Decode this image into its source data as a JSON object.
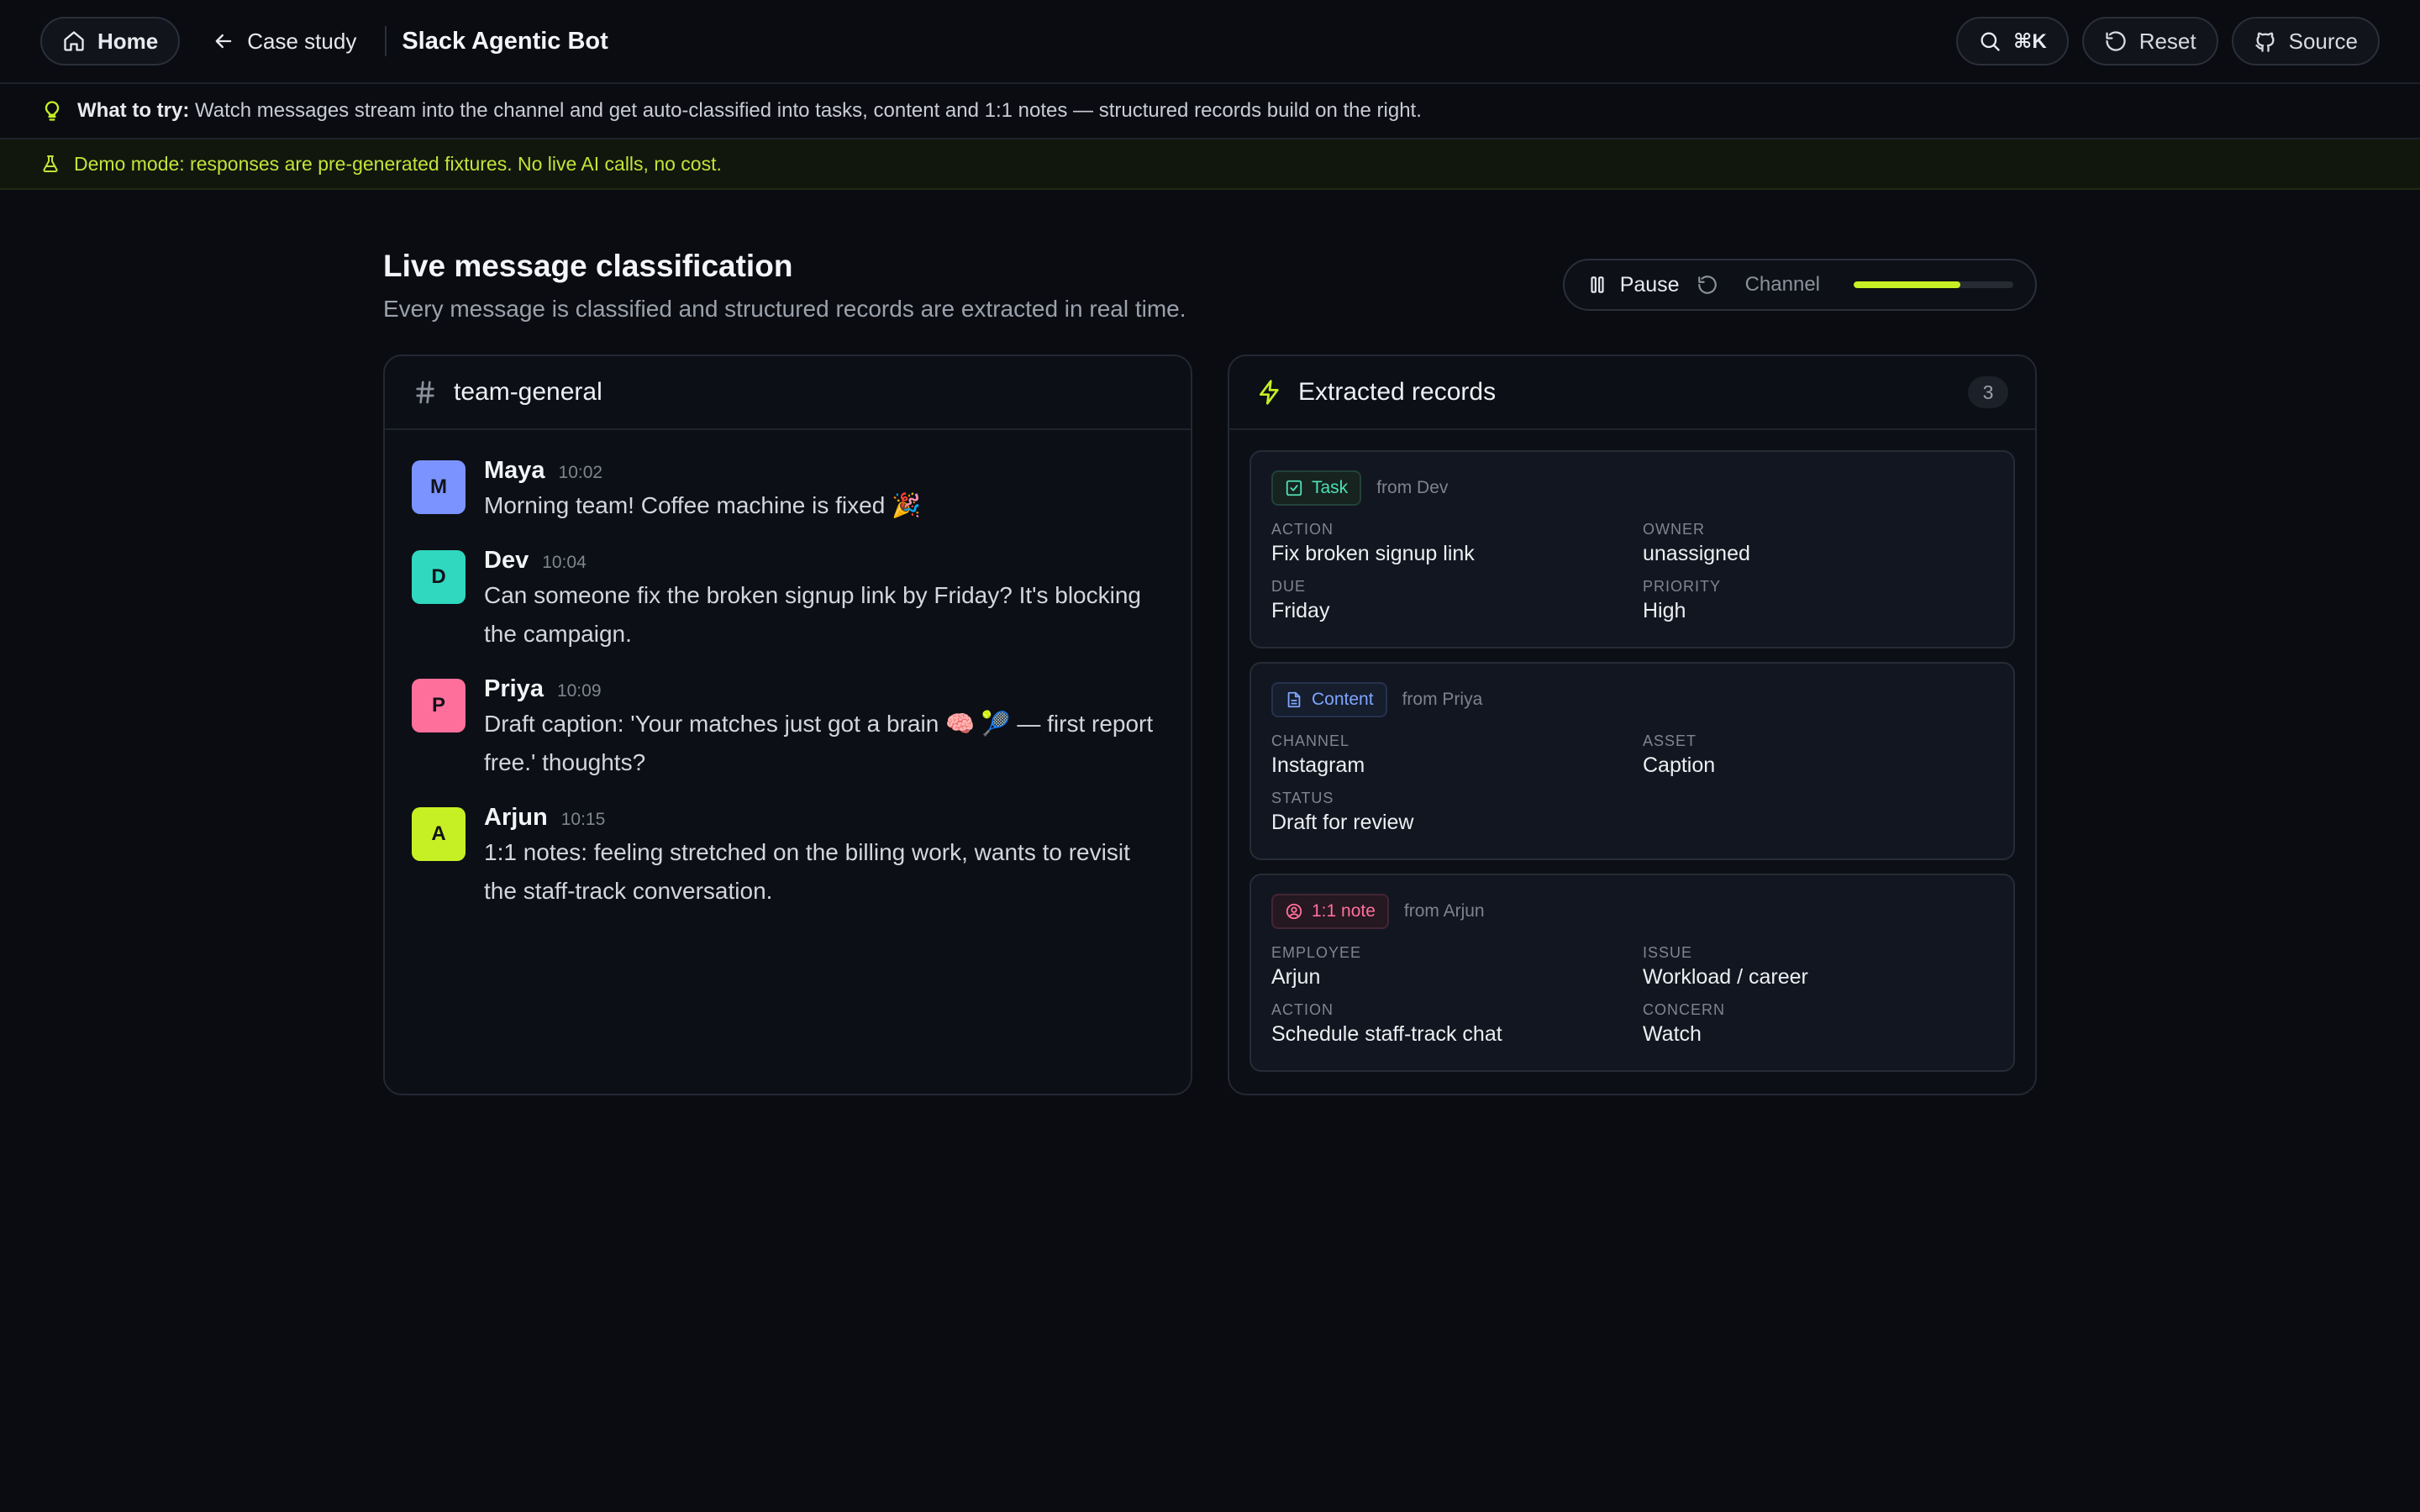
{
  "nav": {
    "home_label": "Home",
    "back_label": "Case study",
    "app_title": "Slack Agentic Bot",
    "search_shortcut": "⌘K",
    "reset_label": "Reset",
    "source_label": "Source"
  },
  "hint": {
    "lead": "What to try:",
    "text": "Watch messages stream into the channel and get auto-classified into tasks, content and 1:1 notes — structured records build on the right."
  },
  "demo_banner": "Demo mode: responses are pre-generated fixtures. No live AI calls, no cost.",
  "main": {
    "title": "Live message classification",
    "subtitle": "Every message is classified and structured records are extracted in real time.",
    "controls": {
      "pause_label": "Pause",
      "channel_label": "Channel",
      "channel_progress": 0.67
    }
  },
  "channel": {
    "name": "team-general",
    "messages": [
      {
        "initial": "M",
        "author": "Maya",
        "time": "10:02",
        "text": "Morning team! Coffee machine is fixed 🎉",
        "color": "#7b93ff"
      },
      {
        "initial": "D",
        "author": "Dev",
        "time": "10:04",
        "text": "Can someone fix the broken signup link by Friday? It's blocking the campaign.",
        "color": "#2fd8bf"
      },
      {
        "initial": "P",
        "author": "Priya",
        "time": "10:09",
        "text": "Draft caption: 'Your matches just got a brain 🧠 🎾 — first report free.' thoughts?",
        "color": "#ff6f9c"
      },
      {
        "initial": "A",
        "author": "Arjun",
        "time": "10:15",
        "text": "1:1 notes: feeling stretched on the billing work, wants to revisit the staff-track conversation.",
        "color": "#c6f024"
      }
    ]
  },
  "records": {
    "title": "Extracted records",
    "count": "3",
    "items": [
      {
        "type": "Task",
        "from": "from Dev",
        "fields": [
          {
            "label": "Action",
            "value": "Fix broken signup link"
          },
          {
            "label": "Owner",
            "value": "unassigned"
          },
          {
            "label": "Due",
            "value": "Friday"
          },
          {
            "label": "Priority",
            "value": "High"
          }
        ]
      },
      {
        "type": "Content",
        "from": "from Priya",
        "fields": [
          {
            "label": "Channel",
            "value": "Instagram"
          },
          {
            "label": "Asset",
            "value": "Caption"
          },
          {
            "label": "Status",
            "value": "Draft for review"
          }
        ]
      },
      {
        "type": "1:1 note",
        "from": "from Arjun",
        "fields": [
          {
            "label": "Employee",
            "value": "Arjun"
          },
          {
            "label": "Issue",
            "value": "Workload / career"
          },
          {
            "label": "Action",
            "value": "Schedule staff-track chat"
          },
          {
            "label": "Concern",
            "value": "Watch"
          }
        ]
      }
    ]
  },
  "colors": {
    "accent": "#c6f024",
    "task": "#4fe0b4",
    "content": "#7ea6ff",
    "note": "#ff6f9c"
  }
}
